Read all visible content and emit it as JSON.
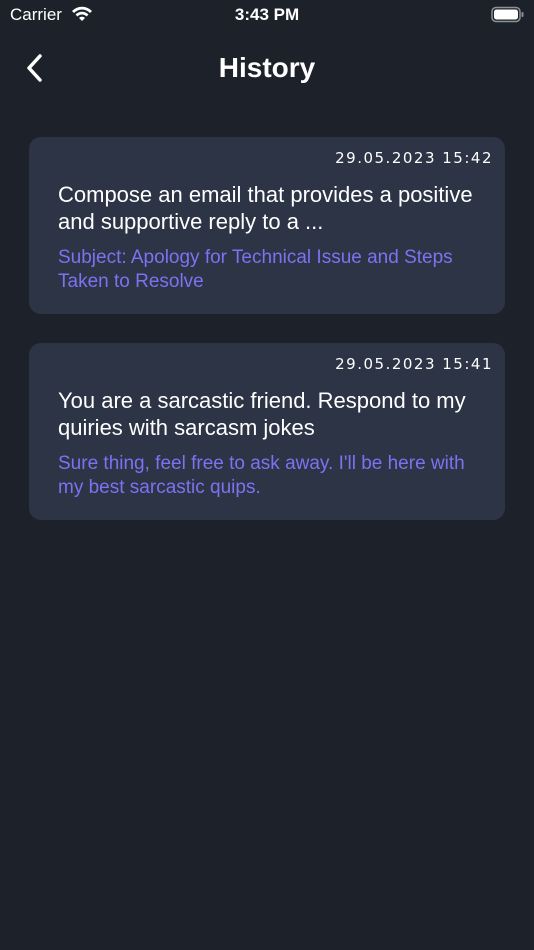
{
  "status_bar": {
    "carrier": "Carrier",
    "time": "3:43 PM",
    "wifi_icon": "wifi-icon",
    "battery_icon": "battery-icon"
  },
  "nav": {
    "title": "History",
    "back_icon": "chevron-left-icon"
  },
  "colors": {
    "background": "#1d222a",
    "card": "#2c3446",
    "accent": "#7b73f0",
    "text": "#ffffff"
  },
  "history": [
    {
      "date": "29.05.2023 15:42",
      "prompt": "Compose an email that provides a positive and supportive reply to a ...",
      "reply": "Subject: Apology for Technical Issue and Steps Taken to Resolve"
    },
    {
      "date": "29.05.2023 15:41",
      "prompt": "You are a sarcastic friend. Respond to my quiries with sarcasm jokes",
      "reply": "Sure thing, feel free to ask away. I'll be here with my best sarcastic quips."
    }
  ]
}
